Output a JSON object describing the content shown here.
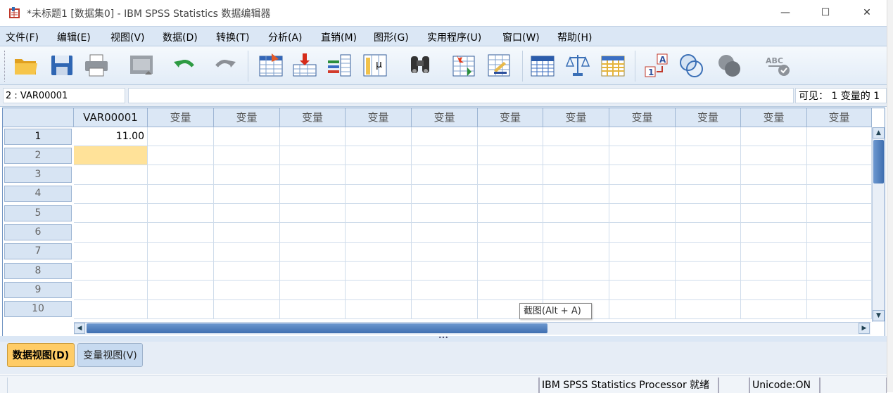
{
  "window": {
    "title": "*未标题1 [数据集0] - IBM SPSS Statistics 数据编辑器",
    "minimize": "—",
    "maximize": "☐",
    "close": "✕"
  },
  "menu": [
    "文件(F)",
    "编辑(E)",
    "视图(V)",
    "数据(D)",
    "转换(T)",
    "分析(A)",
    "直销(M)",
    "图形(G)",
    "实用程序(U)",
    "窗口(W)",
    "帮助(H)"
  ],
  "toolbar_icons": [
    "open-icon",
    "save-icon",
    "print-icon",
    "dialog-recall-icon",
    "undo-icon",
    "redo-icon",
    "goto-case-icon",
    "goto-variable-icon",
    "variables-icon",
    "run-descriptive-icon",
    "find-icon",
    "insert-cases-icon",
    "insert-variable-icon",
    "split-file-icon",
    "weight-cases-icon",
    "select-cases-icon",
    "value-labels-icon",
    "use-sets-icon",
    "show-all-variables-icon",
    "spell-check-icon"
  ],
  "cellbar": {
    "reference": "2 : VAR00001",
    "value": "",
    "visible": "可见： 1 变量的 1"
  },
  "grid": {
    "columns": [
      "VAR00001",
      "变量",
      "变量",
      "变量",
      "变量",
      "变量",
      "变量",
      "变量",
      "变量",
      "变量",
      "变量",
      "变量"
    ],
    "rows": [
      "1",
      "2",
      "3",
      "4",
      "5",
      "6",
      "7",
      "8",
      "9",
      "10"
    ],
    "cells": [
      [
        "11.00"
      ]
    ],
    "selected_cell": {
      "row": 2,
      "column": 1
    }
  },
  "tooltip": "截图(Alt + A)",
  "tabs": {
    "data_view": "数据视图(D)",
    "variable_view": "变量视图(V)"
  },
  "status": {
    "processor": "IBM SPSS Statistics Processor 就绪",
    "unicode": "Unicode:ON"
  },
  "colors": {
    "menubar": "#dbe7f5",
    "selected_cell": "#ffe299",
    "active_tab": "#ffcc66",
    "scroll_thumb": "#3f6fb0"
  }
}
